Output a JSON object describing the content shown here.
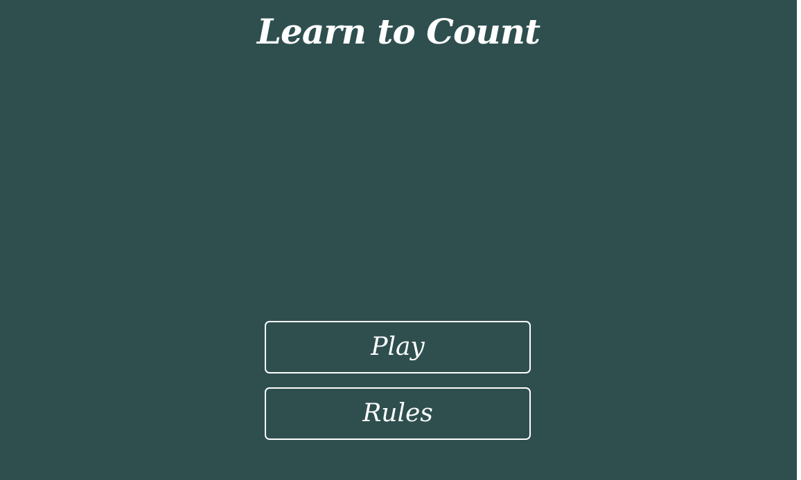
{
  "title": "Learn to Count",
  "menu": {
    "play_label": "Play",
    "rules_label": "Rules"
  },
  "colors": {
    "background": "#2f4f4f",
    "text": "#ffffff",
    "button_border": "#ffffff"
  }
}
